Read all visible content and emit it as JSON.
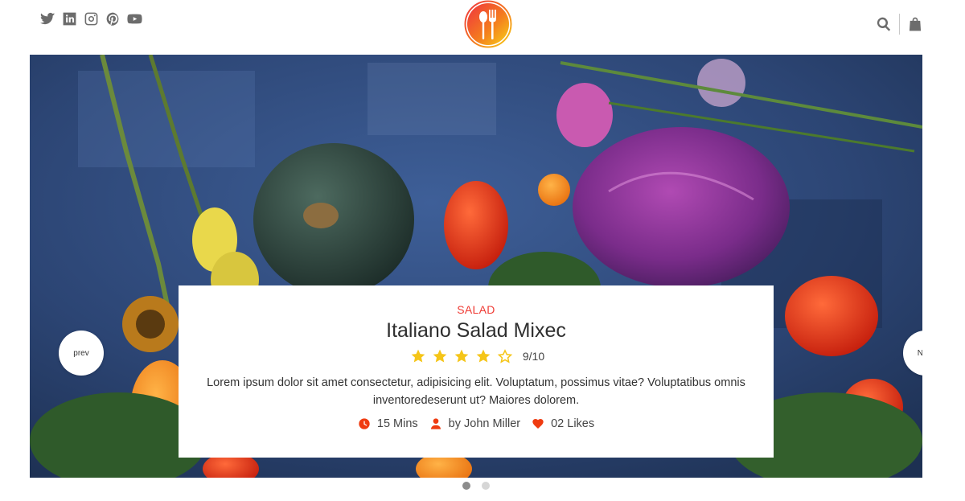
{
  "header": {
    "social_icons": [
      "twitter-icon",
      "linkedin-icon",
      "instagram-icon",
      "pinterest-icon",
      "youtube-icon"
    ],
    "logo": "restaurant-logo",
    "right_icons": [
      "search-icon",
      "shopping-bag-icon"
    ]
  },
  "slider": {
    "prev_label": "prev",
    "next_label": "Next",
    "active_slide": 1,
    "slide_count": 2
  },
  "card": {
    "category": "SALAD",
    "title": "Italiano Salad Mixec",
    "rating": 4,
    "rating_max": 5,
    "rating_text": "9/10",
    "description": "Lorem ipsum dolor sit amet consectetur, adipisicing elit. Voluptatum, possimus vitae? Voluptatibus omnis inventoredeserunt ut? Maiores dolorem.",
    "time": "15 Mins",
    "author": "by John Miller",
    "likes": "02 Likes"
  },
  "colors": {
    "accent": "#ef3b34",
    "star": "#f5c518",
    "icon_gray": "#6c6c6c"
  }
}
